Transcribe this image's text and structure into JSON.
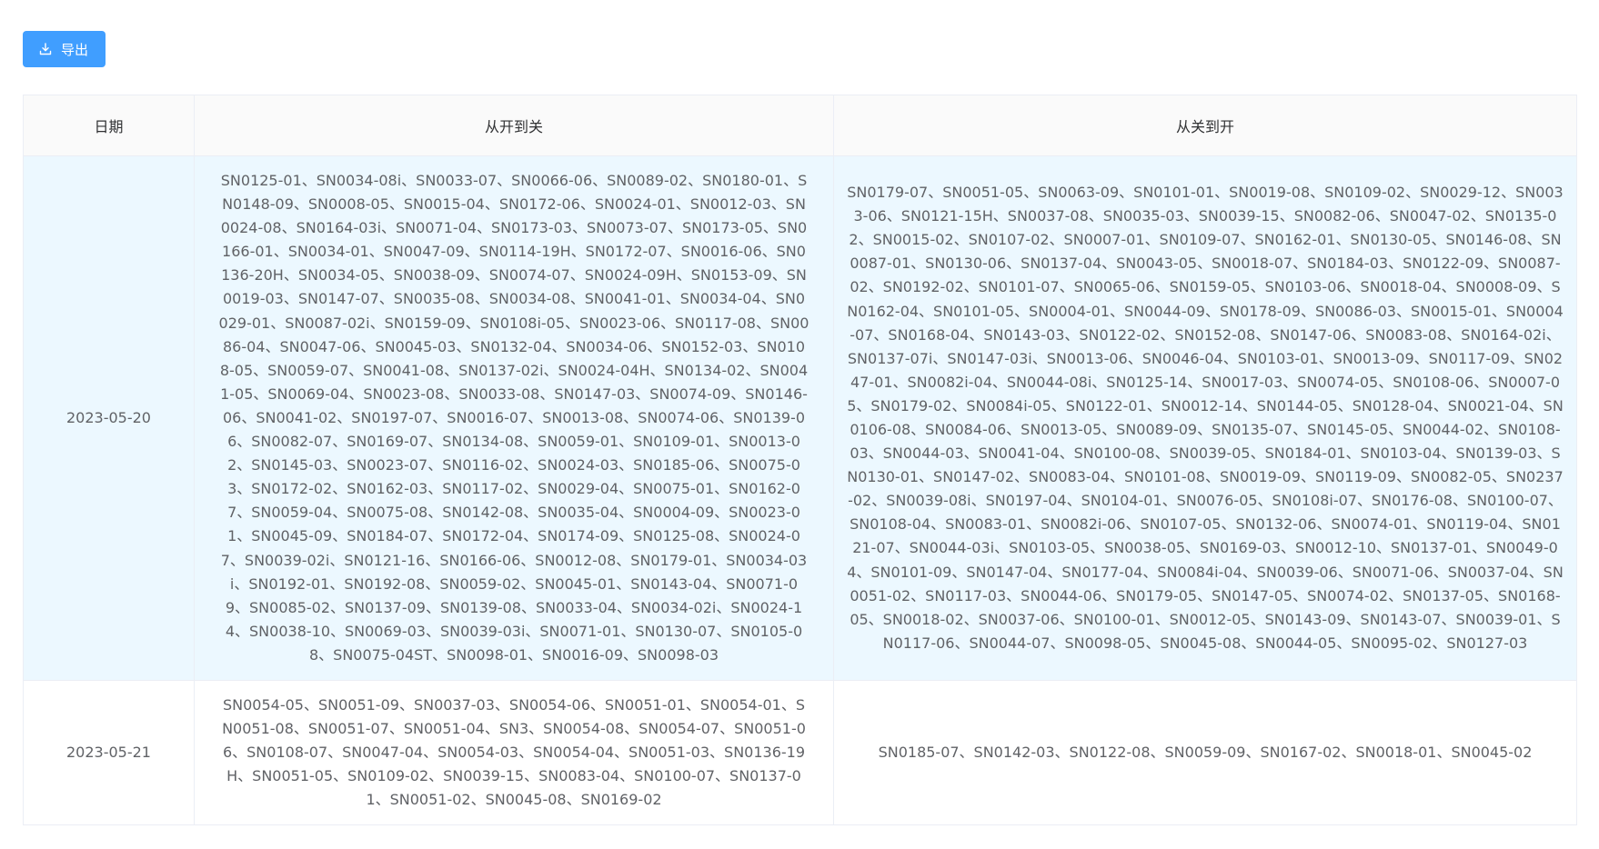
{
  "toolbar": {
    "export_label": "导出",
    "export_icon": "download-icon"
  },
  "table": {
    "headers": {
      "date": "日期",
      "open_to_close": "从开到关",
      "close_to_open": "从关到开"
    },
    "rows": [
      {
        "date": "2023-05-20",
        "highlighted": true,
        "open_to_close": "SN0125-01、SN0034-08i、SN0033-07、SN0066-06、SN0089-02、SN0180-01、SN0148-09、SN0008-05、SN0015-04、SN0172-06、SN0024-01、SN0012-03、SN0024-08、SN0164-03i、SN0071-04、SN0173-03、SN0073-07、SN0173-05、SN0166-01、SN0034-01、SN0047-09、SN0114-19H、SN0172-07、SN0016-06、SN0136-20H、SN0034-05、SN0038-09、SN0074-07、SN0024-09H、SN0153-09、SN0019-03、SN0147-07、SN0035-08、SN0034-08、SN0041-01、SN0034-04、SN0029-01、SN0087-02i、SN0159-09、SN0108i-05、SN0023-06、SN0117-08、SN0086-04、SN0047-06、SN0045-03、SN0132-04、SN0034-06、SN0152-03、SN0108-05、SN0059-07、SN0041-08、SN0137-02i、SN0024-04H、SN0134-02、SN0041-05、SN0069-04、SN0023-08、SN0033-08、SN0147-03、SN0074-09、SN0146-06、SN0041-02、SN0197-07、SN0016-07、SN0013-08、SN0074-06、SN0139-06、SN0082-07、SN0169-07、SN0134-08、SN0059-01、SN0109-01、SN0013-02、SN0145-03、SN0023-07、SN0116-02、SN0024-03、SN0185-06、SN0075-03、SN0172-02、SN0162-03、SN0117-02、SN0029-04、SN0075-01、SN0162-07、SN0059-04、SN0075-08、SN0142-08、SN0035-04、SN0004-09、SN0023-01、SN0045-09、SN0184-07、SN0172-04、SN0174-09、SN0125-08、SN0024-07、SN0039-02i、SN0121-16、SN0166-06、SN0012-08、SN0179-01、SN0034-03i、SN0192-01、SN0192-08、SN0059-02、SN0045-01、SN0143-04、SN0071-09、SN0085-02、SN0137-09、SN0139-08、SN0033-04、SN0034-02i、SN0024-14、SN0038-10、SN0069-03、SN0039-03i、SN0071-01、SN0130-07、SN0105-08、SN0075-04ST、SN0098-01、SN0016-09、SN0098-03",
        "close_to_open": "SN0179-07、SN0051-05、SN0063-09、SN0101-01、SN0019-08、SN0109-02、SN0029-12、SN0033-06、SN0121-15H、SN0037-08、SN0035-03、SN0039-15、SN0082-06、SN0047-02、SN0135-02、SN0015-02、SN0107-02、SN0007-01、SN0109-07、SN0162-01、SN0130-05、SN0146-08、SN0087-01、SN0130-06、SN0137-04、SN0043-05、SN0018-07、SN0184-03、SN0122-09、SN0087-02、SN0192-02、SN0101-07、SN0065-06、SN0159-05、SN0103-06、SN0018-04、SN0008-09、SN0162-04、SN0101-05、SN0004-01、SN0044-09、SN0178-09、SN0086-03、SN0015-01、SN0004-07、SN0168-04、SN0143-03、SN0122-02、SN0152-08、SN0147-06、SN0083-08、SN0164-02i、SN0137-07i、SN0147-03i、SN0013-06、SN0046-04、SN0103-01、SN0013-09、SN0117-09、SN0247-01、SN0082i-04、SN0044-08i、SN0125-14、SN0017-03、SN0074-05、SN0108-06、SN0007-05、SN0179-02、SN0084i-05、SN0122-01、SN0012-14、SN0144-05、SN0128-04、SN0021-04、SN0106-08、SN0084-06、SN0013-05、SN0089-09、SN0135-07、SN0145-05、SN0044-02、SN0108-03、SN0044-03、SN0041-04、SN0100-08、SN0039-05、SN0184-01、SN0103-04、SN0139-03、SN0130-01、SN0147-02、SN0083-04、SN0101-08、SN0019-09、SN0119-09、SN0082-05、SN0237-02、SN0039-08i、SN0197-04、SN0104-01、SN0076-05、SN0108i-07、SN0176-08、SN0100-07、SN0108-04、SN0083-01、SN0082i-06、SN0107-05、SN0132-06、SN0074-01、SN0119-04、SN0121-07、SN0044-03i、SN0103-05、SN0038-05、SN0169-03、SN0012-10、SN0137-01、SN0049-04、SN0101-09、SN0147-04、SN0177-04、SN0084i-04、SN0039-06、SN0071-06、SN0037-04、SN0051-02、SN0117-03、SN0044-06、SN0179-05、SN0147-05、SN0074-02、SN0137-05、SN0168-05、SN0018-02、SN0037-06、SN0100-01、SN0012-05、SN0143-09、SN0143-07、SN0039-01、SN0117-06、SN0044-07、SN0098-05、SN0045-08、SN0044-05、SN0095-02、SN0127-03"
      },
      {
        "date": "2023-05-21",
        "highlighted": false,
        "open_to_close": "SN0054-05、SN0051-09、SN0037-03、SN0054-06、SN0051-01、SN0054-01、SN0051-08、SN0051-07、SN0051-04、SN3、SN0054-08、SN0054-07、SN0051-06、SN0108-07、SN0047-04、SN0054-03、SN0054-04、SN0051-03、SN0136-19H、SN0051-05、SN0109-02、SN0039-15、SN0083-04、SN0100-07、SN0137-01、SN0051-02、SN0045-08、SN0169-02",
        "close_to_open": "SN0185-07、SN0142-03、SN0122-08、SN0059-09、SN0167-02、SN0018-01、SN0045-02"
      }
    ]
  }
}
